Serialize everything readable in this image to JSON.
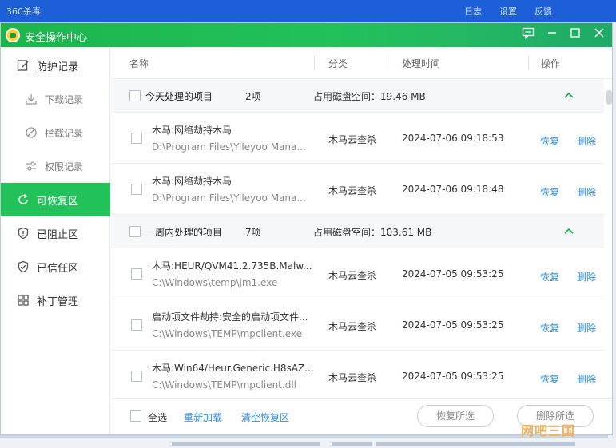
{
  "background_app": {
    "title": "360杀毒",
    "menu": [
      "日志",
      "设置",
      "反馈"
    ]
  },
  "window": {
    "title": "安全操作中心"
  },
  "sidebar": {
    "items": [
      {
        "label": "防护记录",
        "icon": "shield-record-icon",
        "level": "top"
      },
      {
        "label": "下载记录",
        "icon": "download-icon",
        "level": "sub"
      },
      {
        "label": "拦截记录",
        "icon": "block-icon",
        "level": "sub"
      },
      {
        "label": "权限记录",
        "icon": "permission-icon",
        "level": "sub"
      },
      {
        "label": "可恢复区",
        "icon": "restore-icon",
        "level": "top",
        "active": true
      },
      {
        "label": "已阻止区",
        "icon": "blocked-shield-icon",
        "level": "top"
      },
      {
        "label": "已信任区",
        "icon": "trusted-shield-icon",
        "level": "top"
      },
      {
        "label": "补丁管理",
        "icon": "patch-icon",
        "level": "top"
      }
    ]
  },
  "table": {
    "headers": {
      "name": "名称",
      "category": "分类",
      "time": "处理时间",
      "action": "操作"
    },
    "groups": [
      {
        "name": "今天处理的项目",
        "count": "2项",
        "disk": "占用磁盘空间：19.46 MB",
        "items": [
          {
            "name": "木马:网络劫持木马",
            "path": "D:\\Program Files\\Yileyoo Mana...",
            "category": "木马云查杀",
            "time": "2024-07-06 09:18:53",
            "restore": "恢复",
            "delete": "删除"
          },
          {
            "name": "木马:网络劫持木马",
            "path": "D:\\Program Files\\Yileyoo Mana...",
            "category": "木马云查杀",
            "time": "2024-07-06 09:18:48",
            "restore": "恢复",
            "delete": "删除"
          }
        ]
      },
      {
        "name": "一周内处理的项目",
        "count": "7项",
        "disk": "占用磁盘空间：103.61 MB",
        "items": [
          {
            "name": "木马:HEUR/QVM41.2.735B.Malw...",
            "path": "C:\\Windows\\temp\\jm1.exe",
            "category": "木马云查杀",
            "time": "2024-07-05 09:53:25",
            "restore": "恢复",
            "delete": "删除"
          },
          {
            "name": "启动项文件劫持:安全的启动项文件...",
            "path": "C:\\Windows\\TEMP\\mpclient.exe",
            "category": "木马云查杀",
            "time": "2024-07-05 09:53:25",
            "restore": "恢复",
            "delete": "删除"
          },
          {
            "name": "木马:Win64/Heur.Generic.H8sAZ...",
            "path": "C:\\Windows\\TEMP\\mpclient.dll",
            "category": "木马云查杀",
            "time": "2024-07-05 09:53:25",
            "restore": "恢复",
            "delete": "删除"
          }
        ]
      }
    ]
  },
  "footer": {
    "select_all": "全选",
    "reload": "重新加载",
    "clear": "清空恢复区",
    "restore_selected": "恢复所选",
    "delete_selected": "删除所选"
  },
  "watermark": "网吧三国",
  "colors": {
    "accent_green": "#22c15a",
    "link_blue": "#2f8de4"
  }
}
